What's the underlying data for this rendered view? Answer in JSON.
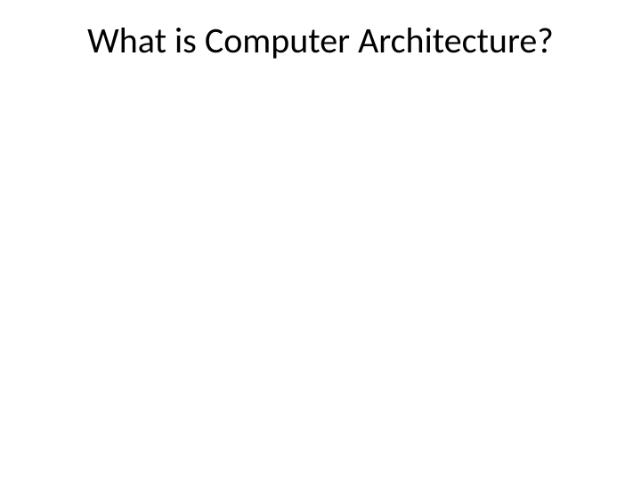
{
  "slide": {
    "title": "What is Computer Architecture?"
  }
}
